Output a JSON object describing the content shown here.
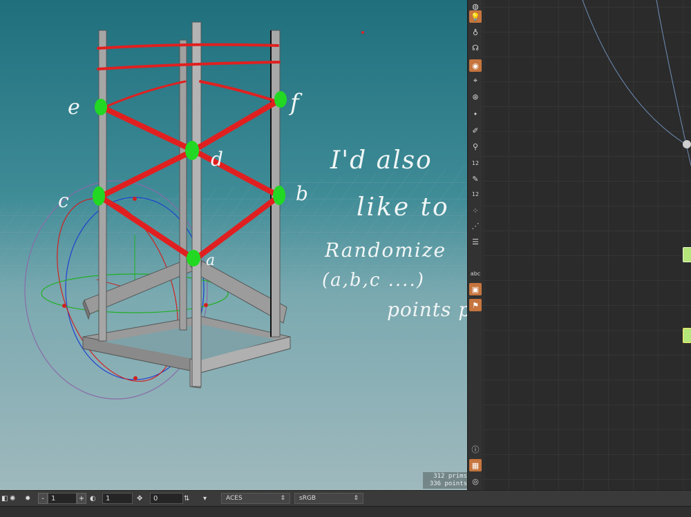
{
  "viewport": {
    "stats": {
      "prims": "312  prims",
      "points": "336 points"
    },
    "point_labels": {
      "a": "a",
      "b": "b",
      "c": "c",
      "d": "d",
      "e": "e",
      "f": "f"
    },
    "annotation": {
      "line1": "I'd  also",
      "line2": "like  to",
      "line3": "Randomize",
      "line4": "(a,b,c ....)",
      "line5": "points  position."
    }
  },
  "shelf": {
    "tools": [
      {
        "icon": "info-sphere-icon",
        "active": false
      },
      {
        "icon": "light-bulb-icon",
        "active": true
      },
      {
        "icon": "bulb-icon",
        "active": false
      },
      {
        "icon": "camera-light-icon",
        "active": false
      },
      {
        "icon": "render-icon",
        "active": true
      },
      {
        "icon": "handle-icon",
        "active": false
      },
      {
        "icon": "eye-handle-icon",
        "active": false
      },
      {
        "icon": "dot-icon",
        "active": false
      },
      {
        "icon": "brush-icon",
        "active": false
      },
      {
        "icon": "pin-icon",
        "active": false
      },
      {
        "icon": "point-number-icon",
        "active": false,
        "text": "12"
      },
      {
        "icon": "paint-icon",
        "active": false
      },
      {
        "icon": "prim-number-icon",
        "active": false,
        "text": "12"
      },
      {
        "icon": "normals-icon",
        "active": false
      },
      {
        "icon": "vertex-icon",
        "active": false
      },
      {
        "icon": "list-icon",
        "active": false
      },
      {
        "icon": "text-abc-icon",
        "active": false,
        "text": "abc"
      },
      {
        "icon": "image-icon",
        "active": true
      },
      {
        "icon": "location-icon",
        "active": true
      }
    ],
    "bottom_tools": [
      {
        "icon": "info-icon",
        "active": false
      },
      {
        "icon": "layout-icon",
        "active": true
      },
      {
        "icon": "eye-icon",
        "active": false
      }
    ]
  },
  "bottombar": {
    "step_value": "1",
    "gamma_value": "1",
    "exposure_value": "0",
    "colorspace": "ACES",
    "display": "sRGB",
    "minus": "-",
    "plus": "+"
  }
}
